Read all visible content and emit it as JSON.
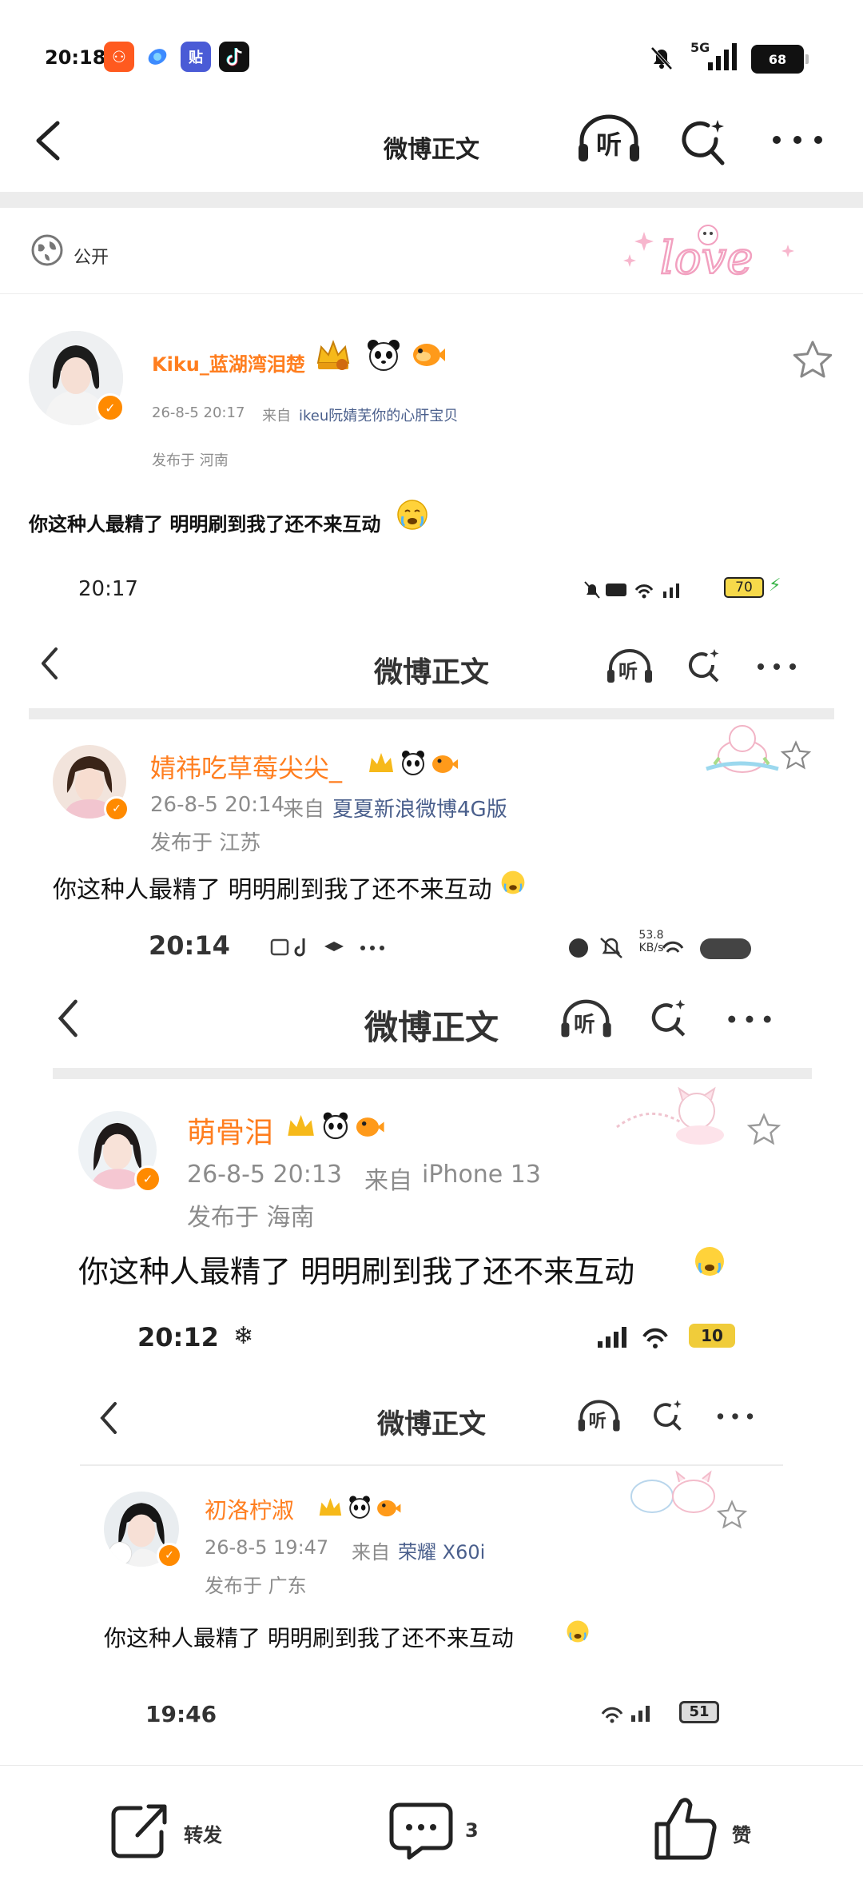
{
  "status_bar": {
    "time": "20:18",
    "app_icons": [
      "kuaishou-app-icon",
      "browser-app-icon",
      "tieba-app-icon",
      "tiktok-app-icon"
    ],
    "network": "5G",
    "battery": "68"
  },
  "nav": {
    "title": "微博正文",
    "listen_label": "听"
  },
  "visibility": {
    "label": "公开",
    "sticker_text": "love"
  },
  "post": {
    "username": "Kiku_蓝湖湾泪楚",
    "timestamp": "26-8-5 20:17",
    "source_prefix": "来自",
    "source": "ikeu阮婧芜你的心肝宝贝",
    "location": "发布于 河南",
    "text": "你这种人最精了 明明刷到我了还不来互动"
  },
  "nested": [
    {
      "status_time": "20:17",
      "battery": "70",
      "nav_title": "微博正文",
      "username": "婧祎吃草莓尖尖_",
      "timestamp": "26-8-5 20:14",
      "source_prefix": "来自",
      "source": "夏夏新浪微博4G版",
      "location": "发布于 江苏",
      "text": "你这种人最精了 明明刷到我了还不来互动"
    },
    {
      "status_time": "20:14",
      "speed": "53.8 KB/s",
      "nav_title": "微博正文",
      "username": "萌骨泪",
      "timestamp": "26-8-5 20:13",
      "source_prefix": "来自",
      "source": "iPhone 13",
      "location": "发布于 海南",
      "text": "你这种人最精了 明明刷到我了还不来互动"
    },
    {
      "status_time": "20:12",
      "battery": "10",
      "nav_title": "微博正文",
      "username": "初洛柠淑",
      "timestamp": "26-8-5 19:47",
      "source_prefix": "来自",
      "source": "荣耀 X60i",
      "location": "发布于 广东",
      "text": "你这种人最精了 明明刷到我了还不来互动"
    },
    {
      "status_time": "19:46",
      "battery": "51"
    }
  ],
  "actions": {
    "repost_label": "转发",
    "comment_count": "3",
    "like_label": "赞"
  },
  "colors": {
    "username": "#ff7e1f",
    "source_link": "#4a5f8c",
    "meta": "#8c8c8c",
    "band": "#ececec"
  }
}
